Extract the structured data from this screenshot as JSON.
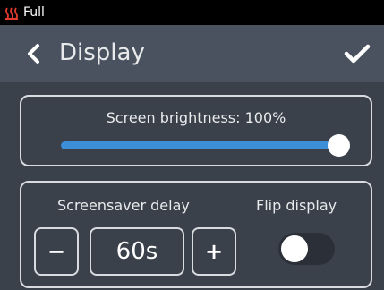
{
  "status_bar": {
    "icon": "heater-icon",
    "text": "Full",
    "icon_color": "#e23b2e"
  },
  "header": {
    "title": "Display",
    "back_icon": "chevron-left-icon",
    "confirm_icon": "checkmark-icon"
  },
  "brightness": {
    "label": "Screen brightness: 100%",
    "level": 1.0,
    "accent": "#3c8fd6"
  },
  "screensaver": {
    "label": "Screensaver delay",
    "decrement_label": "−",
    "increment_label": "+",
    "value": "60s"
  },
  "flip": {
    "label": "Flip display",
    "enabled": false
  }
}
